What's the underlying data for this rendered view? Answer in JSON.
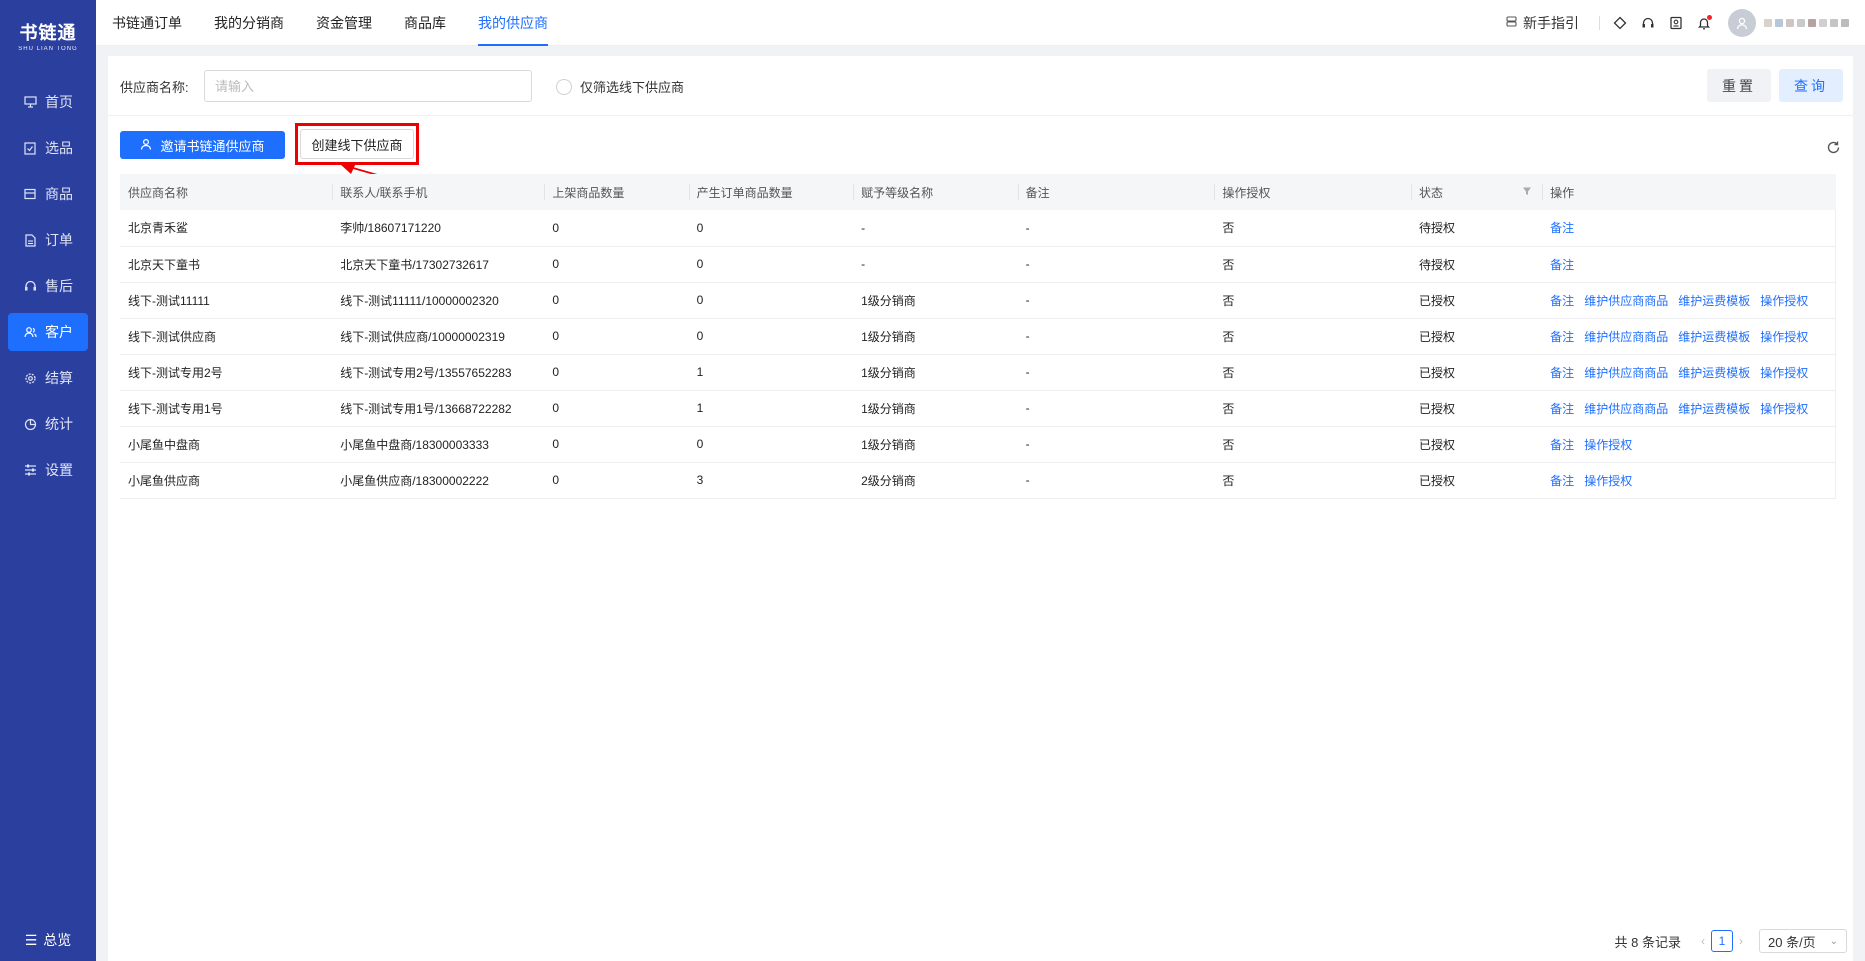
{
  "app": {
    "logo_main": "书链通",
    "logo_sub": "SHU LIAN TONG"
  },
  "sidebar": {
    "items": [
      {
        "label": "首页",
        "icon": "monitor-icon"
      },
      {
        "label": "选品",
        "icon": "select-icon"
      },
      {
        "label": "商品",
        "icon": "box-icon"
      },
      {
        "label": "订单",
        "icon": "order-icon"
      },
      {
        "label": "售后",
        "icon": "headset-icon"
      },
      {
        "label": "客户",
        "icon": "users-icon",
        "active": true
      },
      {
        "label": "结算",
        "icon": "gear-icon"
      },
      {
        "label": "统计",
        "icon": "pie-icon"
      },
      {
        "label": "设置",
        "icon": "sliders-icon"
      }
    ],
    "overview_label": "总览"
  },
  "topbar": {
    "tabs": [
      {
        "label": "书链通订单"
      },
      {
        "label": "我的分销商"
      },
      {
        "label": "资金管理"
      },
      {
        "label": "商品库"
      },
      {
        "label": "我的供应商",
        "active": true
      }
    ],
    "guide_label": "新手指引"
  },
  "filter": {
    "supplier_name_label": "供应商名称:",
    "supplier_name_placeholder": "请输入",
    "supplier_name_value": "",
    "offline_only_label": "仅筛选线下供应商",
    "offline_only_checked": false,
    "reset_label": "重置",
    "query_label": "查询"
  },
  "actions": {
    "invite_label": "邀请书链通供应商",
    "create_label": "创建线下供应商"
  },
  "table": {
    "headers": [
      "供应商名称",
      "联系人/联系手机",
      "上架商品数量",
      "产生订单商品数量",
      "赋予等级名称",
      "备注",
      "操作授权",
      "状态",
      "操作"
    ],
    "rows": [
      {
        "name": "北京青禾鲨",
        "contact": "李帅/18607171220",
        "listed": "0",
        "ordered": "0",
        "level": "-",
        "remark": "-",
        "auth": "否",
        "status": "待授权",
        "ops": [
          "备注"
        ]
      },
      {
        "name": "北京天下童书",
        "contact": "北京天下童书/17302732617",
        "listed": "0",
        "ordered": "0",
        "level": "-",
        "remark": "-",
        "auth": "否",
        "status": "待授权",
        "ops": [
          "备注"
        ]
      },
      {
        "name": "线下-测试11111",
        "contact": "线下-测试11111/10000002320",
        "listed": "0",
        "ordered": "0",
        "level": "1级分销商",
        "remark": "-",
        "auth": "否",
        "status": "已授权",
        "ops": [
          "备注",
          "维护供应商商品",
          "维护运费模板",
          "操作授权"
        ]
      },
      {
        "name": "线下-测试供应商",
        "contact": "线下-测试供应商/10000002319",
        "listed": "0",
        "ordered": "0",
        "level": "1级分销商",
        "remark": "-",
        "auth": "否",
        "status": "已授权",
        "ops": [
          "备注",
          "维护供应商商品",
          "维护运费模板",
          "操作授权"
        ]
      },
      {
        "name": "线下-测试专用2号",
        "contact": "线下-测试专用2号/13557652283",
        "listed": "0",
        "ordered": "1",
        "level": "1级分销商",
        "remark": "-",
        "auth": "否",
        "status": "已授权",
        "ops": [
          "备注",
          "维护供应商商品",
          "维护运费模板",
          "操作授权"
        ]
      },
      {
        "name": "线下-测试专用1号",
        "contact": "线下-测试专用1号/13668722282",
        "listed": "0",
        "ordered": "1",
        "level": "1级分销商",
        "remark": "-",
        "auth": "否",
        "status": "已授权",
        "ops": [
          "备注",
          "维护供应商商品",
          "维护运费模板",
          "操作授权"
        ]
      },
      {
        "name": "小尾鱼中盘商",
        "contact": "小尾鱼中盘商/18300003333",
        "listed": "0",
        "ordered": "0",
        "level": "1级分销商",
        "remark": "-",
        "auth": "否",
        "status": "已授权",
        "ops": [
          "备注",
          "操作授权"
        ]
      },
      {
        "name": "小尾鱼供应商",
        "contact": "小尾鱼供应商/18300002222",
        "listed": "0",
        "ordered": "3",
        "level": "2级分销商",
        "remark": "-",
        "auth": "否",
        "status": "已授权",
        "ops": [
          "备注",
          "操作授权"
        ]
      }
    ]
  },
  "pagination": {
    "total_label": "共 8 条记录",
    "current_page": "1",
    "page_size": "20 条/页"
  },
  "colors": {
    "sidebar_bg": "#2b3f9e",
    "primary": "#1f6fff",
    "highlight": "#ee0000"
  }
}
